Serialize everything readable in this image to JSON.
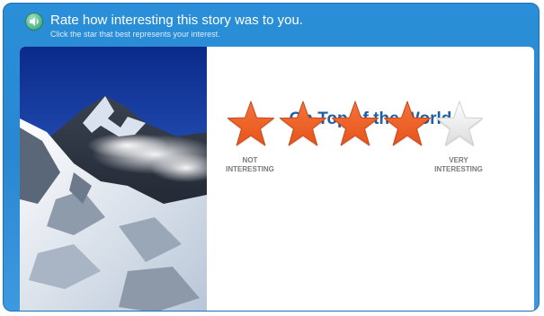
{
  "header": {
    "title": "Rate how interesting this story was to you.",
    "subtitle": "Click the star that best represents your interest.",
    "audio_icon": "speaker-icon"
  },
  "story": {
    "title": "On Top of the World"
  },
  "rating": {
    "max_stars": 5,
    "selected": 4,
    "filled_color": "#e8541a",
    "empty_color": "#f2f2f2",
    "low_label_line1": "NOT",
    "low_label_line2": "INTERESTING",
    "high_label_line1": "VERY",
    "high_label_line2": "INTERESTING"
  },
  "colors": {
    "frame": "#2a8fd8",
    "title_text": "#1a5fa8"
  }
}
